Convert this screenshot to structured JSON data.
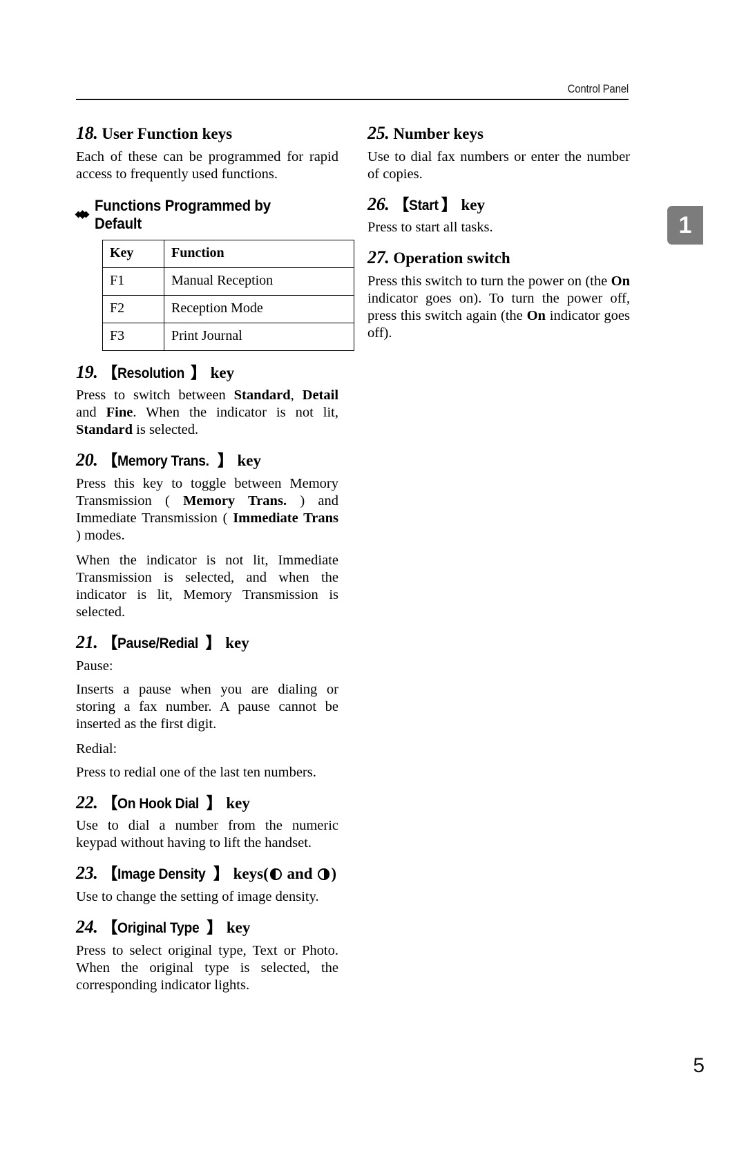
{
  "header": {
    "running_title": "Control Panel"
  },
  "chapter_tab": {
    "number": "1"
  },
  "folio": {
    "page_number": "5"
  },
  "left_column": {
    "sections": [
      {
        "number": "18.",
        "title": "User Function keys",
        "title_style": "serif",
        "body": "Each of these can be programmed for rapid access to frequently used functions."
      },
      {
        "number": "19.",
        "key_label": "Resolution",
        "suffix": "key",
        "title_style": "key",
        "body_parts": [
          {
            "text": "Press to switch between ",
            "bold": false
          },
          {
            "text": "Standard",
            "bold": true
          },
          {
            "text": ", ",
            "bold": false
          },
          {
            "text": "Detail",
            "bold": true
          },
          {
            "text": " and ",
            "bold": false
          },
          {
            "text": "Fine",
            "bold": true
          },
          {
            "text": ". When the indicator is not lit, ",
            "bold": false
          },
          {
            "text": "Standard",
            "bold": true
          },
          {
            "text": " is selected.",
            "bold": false
          }
        ]
      },
      {
        "number": "20.",
        "key_label": "Memory Trans.",
        "suffix": "key",
        "title_style": "key",
        "body_parts": [
          {
            "text": "Press this key to toggle between Memory Transmission ( ",
            "bold": false
          },
          {
            "text": "Memory Trans.",
            "bold": true
          },
          {
            "text": " ) and Immediate Transmission ( ",
            "bold": false
          },
          {
            "text": "Immediate Trans",
            "bold": true
          },
          {
            "text": " ) modes.",
            "bold": false
          }
        ],
        "body2": "When the indicator is not lit, Immediate Transmission is selected, and when the indicator is lit, Memory Transmission is selected."
      },
      {
        "number": "21.",
        "key_label": "Pause/Redial",
        "suffix": "key",
        "title_style": "key",
        "sub_label_1": "Pause:",
        "body": "Inserts a pause when you are dialing or storing a fax number. A pause cannot be inserted as the first digit.",
        "sub_label_2": "Redial:",
        "body2": "Press to redial one of the last ten numbers."
      },
      {
        "number": "22.",
        "key_label": "On Hook Dial",
        "suffix": "key",
        "title_style": "key",
        "body": "Use to dial a number from the numeric keypad without having to lift the handset."
      },
      {
        "number": "23.",
        "key_label": "Image Density",
        "suffix": "keys",
        "title_style": "key-icons",
        "icon_prefix": "(",
        "icon_light": "density-light-icon",
        "icon_joiner": "and",
        "icon_dark": "density-dark-icon",
        "icon_suffix": ")",
        "body": "Use to change the setting of image density."
      },
      {
        "number": "24.",
        "key_label": "Original Type",
        "suffix": "key",
        "title_style": "key",
        "body": "Press to select original type, Text or Photo. When the original type is selected, the corresponding indicator lights."
      }
    ],
    "default_functions": {
      "bullet_title": "Functions Programmed by Default",
      "columns": [
        "Key",
        "Function"
      ],
      "rows": [
        [
          "F1",
          "Manual Reception"
        ],
        [
          "F2",
          "Reception Mode"
        ],
        [
          "F3",
          "Print Journal"
        ]
      ]
    }
  },
  "right_column": {
    "sections": [
      {
        "number": "25.",
        "title": "Number keys",
        "title_style": "serif",
        "body": "Use to dial fax numbers or enter the number of copies."
      },
      {
        "number": "26.",
        "key_label": "Start",
        "suffix": "key",
        "title_style": "key",
        "body": "Press to start all tasks."
      },
      {
        "number": "27.",
        "title": "Operation switch",
        "title_style": "serif",
        "body_parts": [
          {
            "text": "Press this switch to turn the power on (the ",
            "bold": false
          },
          {
            "text": "On",
            "bold": true
          },
          {
            "text": " indicator goes on). To turn the power off, press this switch again (the ",
            "bold": false
          },
          {
            "text": "On",
            "bold": true
          },
          {
            "text": " indicator goes off).",
            "bold": false
          }
        ]
      }
    ]
  }
}
